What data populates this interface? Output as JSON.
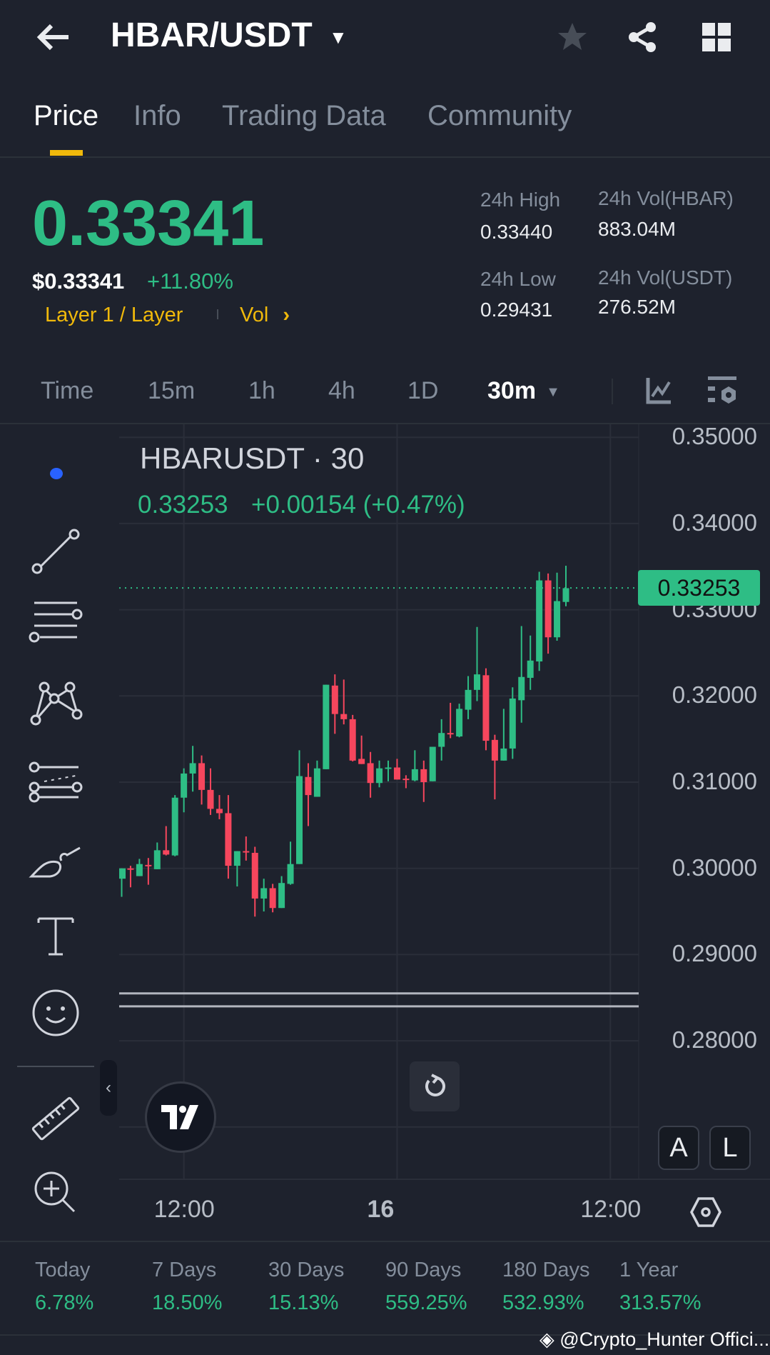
{
  "header": {
    "title": "HBAR/USDT"
  },
  "tabs": [
    {
      "label": "Price"
    },
    {
      "label": "Info"
    },
    {
      "label": "Trading Data"
    },
    {
      "label": "Community"
    }
  ],
  "ticker": {
    "last_price": "0.33341",
    "usd_price": "$0.33341",
    "change_pct": "+11.80%",
    "category": "Layer 1 / Layer",
    "vol_link": "Vol",
    "stats": [
      {
        "label": "24h High",
        "value": "0.33440"
      },
      {
        "label": "24h Vol(HBAR)",
        "value": "883.04M"
      },
      {
        "label": "24h Low",
        "value": "0.29431"
      },
      {
        "label": "24h Vol(USDT)",
        "value": "276.52M"
      }
    ]
  },
  "timeframes": [
    {
      "label": "Time"
    },
    {
      "label": "15m"
    },
    {
      "label": "1h"
    },
    {
      "label": "4h"
    },
    {
      "label": "1D"
    },
    {
      "label": "30m"
    }
  ],
  "chart_legend": {
    "symbol": "HBARUSDT · 30",
    "close": "0.33253",
    "change": "+0.00154 (+0.47%)"
  },
  "chart_buttons": {
    "auto": "A",
    "log": "L"
  },
  "colors": {
    "up": "#2ebd85",
    "down": "#f6465d",
    "accent": "#f0b90b",
    "bg": "#1e222d"
  },
  "chart_data": {
    "type": "candlestick",
    "title": "HBARUSDT · 30",
    "last_price_label": "0.33253",
    "y_ticks": [
      "0.35000",
      "0.34000",
      "0.33000",
      "0.32000",
      "0.31000",
      "0.30000",
      "0.29000",
      "0.28000"
    ],
    "ylim": [
      0.27,
      0.35
    ],
    "x_ticks": [
      {
        "label": "12:00",
        "index": 7
      },
      {
        "label": "16",
        "index": 31
      },
      {
        "label": "12:00",
        "index": 55
      }
    ],
    "horizontal_drawing": [
      0.2855,
      0.284
    ],
    "candles": [
      [
        0.2988,
        0.3,
        0.3,
        0.2967
      ],
      [
        0.3,
        0.2999,
        0.3003,
        0.2978
      ],
      [
        0.2991,
        0.3005,
        0.3011,
        0.2991
      ],
      [
        0.3004,
        0.3003,
        0.3012,
        0.2981
      ],
      [
        0.2999,
        0.3021,
        0.303,
        0.2999
      ],
      [
        0.3021,
        0.3016,
        0.3049,
        0.3015
      ],
      [
        0.3015,
        0.3082,
        0.3085,
        0.3014
      ],
      [
        0.3082,
        0.311,
        0.3116,
        0.3065
      ],
      [
        0.311,
        0.3122,
        0.3142,
        0.3089
      ],
      [
        0.3122,
        0.3091,
        0.3131,
        0.3074
      ],
      [
        0.3091,
        0.3069,
        0.3116,
        0.3062
      ],
      [
        0.3069,
        0.3064,
        0.3085,
        0.3057
      ],
      [
        0.3064,
        0.3003,
        0.3085,
        0.2988
      ],
      [
        0.3003,
        0.302,
        0.302,
        0.2979
      ],
      [
        0.302,
        0.3019,
        0.3037,
        0.3009
      ],
      [
        0.3018,
        0.2965,
        0.3025,
        0.2944
      ],
      [
        0.2965,
        0.2977,
        0.2988,
        0.295
      ],
      [
        0.2977,
        0.2954,
        0.2982,
        0.2949
      ],
      [
        0.2954,
        0.2983,
        0.2991,
        0.2954
      ],
      [
        0.2982,
        0.3005,
        0.3031,
        0.2981
      ],
      [
        0.3005,
        0.3107,
        0.3137,
        0.3005
      ],
      [
        0.3106,
        0.3085,
        0.3122,
        0.3049
      ],
      [
        0.3083,
        0.3116,
        0.3125,
        0.3083
      ],
      [
        0.3115,
        0.3213,
        0.3213,
        0.3115
      ],
      [
        0.3212,
        0.3179,
        0.3225,
        0.3156
      ],
      [
        0.3179,
        0.3173,
        0.3219,
        0.3167
      ],
      [
        0.3173,
        0.3125,
        0.3178,
        0.3124
      ],
      [
        0.3127,
        0.3121,
        0.3154,
        0.3121
      ],
      [
        0.3122,
        0.3099,
        0.3135,
        0.3082
      ],
      [
        0.3099,
        0.3116,
        0.3125,
        0.3094
      ],
      [
        0.3116,
        0.3117,
        0.3125,
        0.3101
      ],
      [
        0.3117,
        0.3103,
        0.3127,
        0.3103
      ],
      [
        0.3104,
        0.3103,
        0.3108,
        0.3093
      ],
      [
        0.3102,
        0.3115,
        0.3137,
        0.3101
      ],
      [
        0.3115,
        0.31,
        0.3125,
        0.3077
      ],
      [
        0.3101,
        0.3141,
        0.3141,
        0.3101
      ],
      [
        0.3141,
        0.3157,
        0.3173,
        0.3125
      ],
      [
        0.3157,
        0.3156,
        0.3192,
        0.3151
      ],
      [
        0.3153,
        0.3185,
        0.3191,
        0.3152
      ],
      [
        0.3184,
        0.3207,
        0.3223,
        0.3173
      ],
      [
        0.3207,
        0.3225,
        0.328,
        0.3194
      ],
      [
        0.3224,
        0.3148,
        0.3232,
        0.3137
      ],
      [
        0.3149,
        0.3125,
        0.3155,
        0.308
      ],
      [
        0.3125,
        0.3139,
        0.3185,
        0.3125
      ],
      [
        0.3139,
        0.3197,
        0.321,
        0.3127
      ],
      [
        0.3195,
        0.3222,
        0.3281,
        0.3169
      ],
      [
        0.3221,
        0.3241,
        0.327,
        0.3207
      ],
      [
        0.324,
        0.3334,
        0.3344,
        0.3229
      ],
      [
        0.3334,
        0.3268,
        0.3342,
        0.3249
      ],
      [
        0.3268,
        0.331,
        0.3343,
        0.3264
      ],
      [
        0.3309,
        0.3325,
        0.3351,
        0.3304
      ]
    ]
  },
  "performance": [
    {
      "label": "Today",
      "value": "6.78%"
    },
    {
      "label": "7 Days",
      "value": "18.50%"
    },
    {
      "label": "30 Days",
      "value": "15.13%"
    },
    {
      "label": "90 Days",
      "value": "559.25%"
    },
    {
      "label": "180 Days",
      "value": "532.93%"
    },
    {
      "label": "1 Year",
      "value": "313.57%"
    }
  ],
  "watermark": "@Crypto_Hunter Offici..."
}
